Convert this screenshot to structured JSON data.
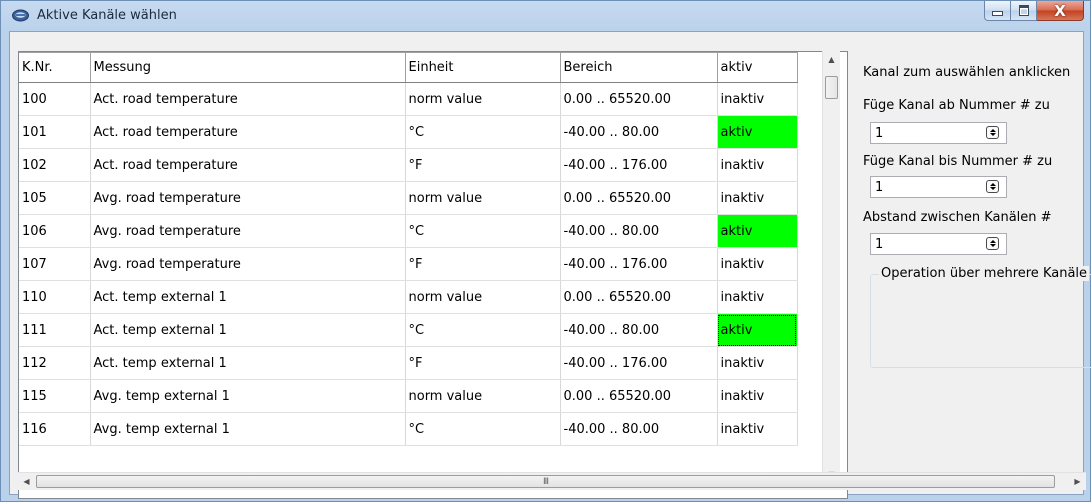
{
  "window": {
    "title": "Aktive Kanäle wählen",
    "close_glyph": "X"
  },
  "table": {
    "headers": [
      "K.Nr.",
      "Messung",
      "Einheit",
      "Bereich",
      "aktiv"
    ],
    "rows": [
      {
        "nr": "100",
        "messung": "Act. road temperature",
        "einheit": "norm value",
        "bereich": "0.00 .. 65520.00",
        "aktiv": "inaktiv"
      },
      {
        "nr": "101",
        "messung": "Act. road temperature",
        "einheit": "°C",
        "bereich": "-40.00 .. 80.00",
        "aktiv": "aktiv"
      },
      {
        "nr": "102",
        "messung": "Act. road temperature",
        "einheit": "°F",
        "bereich": "-40.00 .. 176.00",
        "aktiv": "inaktiv"
      },
      {
        "nr": "105",
        "messung": "Avg. road temperature",
        "einheit": "norm value",
        "bereich": "0.00 .. 65520.00",
        "aktiv": "inaktiv"
      },
      {
        "nr": "106",
        "messung": "Avg. road temperature",
        "einheit": "°C",
        "bereich": "-40.00 .. 80.00",
        "aktiv": "aktiv"
      },
      {
        "nr": "107",
        "messung": "Avg. road temperature",
        "einheit": "°F",
        "bereich": "-40.00 .. 176.00",
        "aktiv": "inaktiv"
      },
      {
        "nr": "110",
        "messung": "Act. temp external 1",
        "einheit": "norm value",
        "bereich": "0.00 .. 65520.00",
        "aktiv": "inaktiv"
      },
      {
        "nr": "111",
        "messung": "Act. temp external 1",
        "einheit": "°C",
        "bereich": "-40.00 .. 80.00",
        "aktiv": "aktiv"
      },
      {
        "nr": "112",
        "messung": "Act. temp external 1",
        "einheit": "°F",
        "bereich": "-40.00 .. 176.00",
        "aktiv": "inaktiv"
      },
      {
        "nr": "115",
        "messung": "Avg. temp external 1",
        "einheit": "norm value",
        "bereich": "0.00 .. 65520.00",
        "aktiv": "inaktiv"
      },
      {
        "nr": "116",
        "messung": "Avg. temp external 1",
        "einheit": "°C",
        "bereich": "-40.00 .. 80.00",
        "aktiv": "inaktiv"
      }
    ],
    "active_color": "#00ff00",
    "focused_row": 7
  },
  "scrollbar": {
    "h_thumb_glyph": "III"
  },
  "panel": {
    "hint": "Kanal zum auswählen anklicken",
    "from_label": "Füge Kanal ab Nummer # zu",
    "from_value": "1",
    "to_label": "Füge Kanal bis Nummer # zu",
    "to_value": "1",
    "step_label": "Abstand zwischen Kanälen #",
    "step_value": "1",
    "group_title": "Operation über mehrere Kanäle"
  }
}
